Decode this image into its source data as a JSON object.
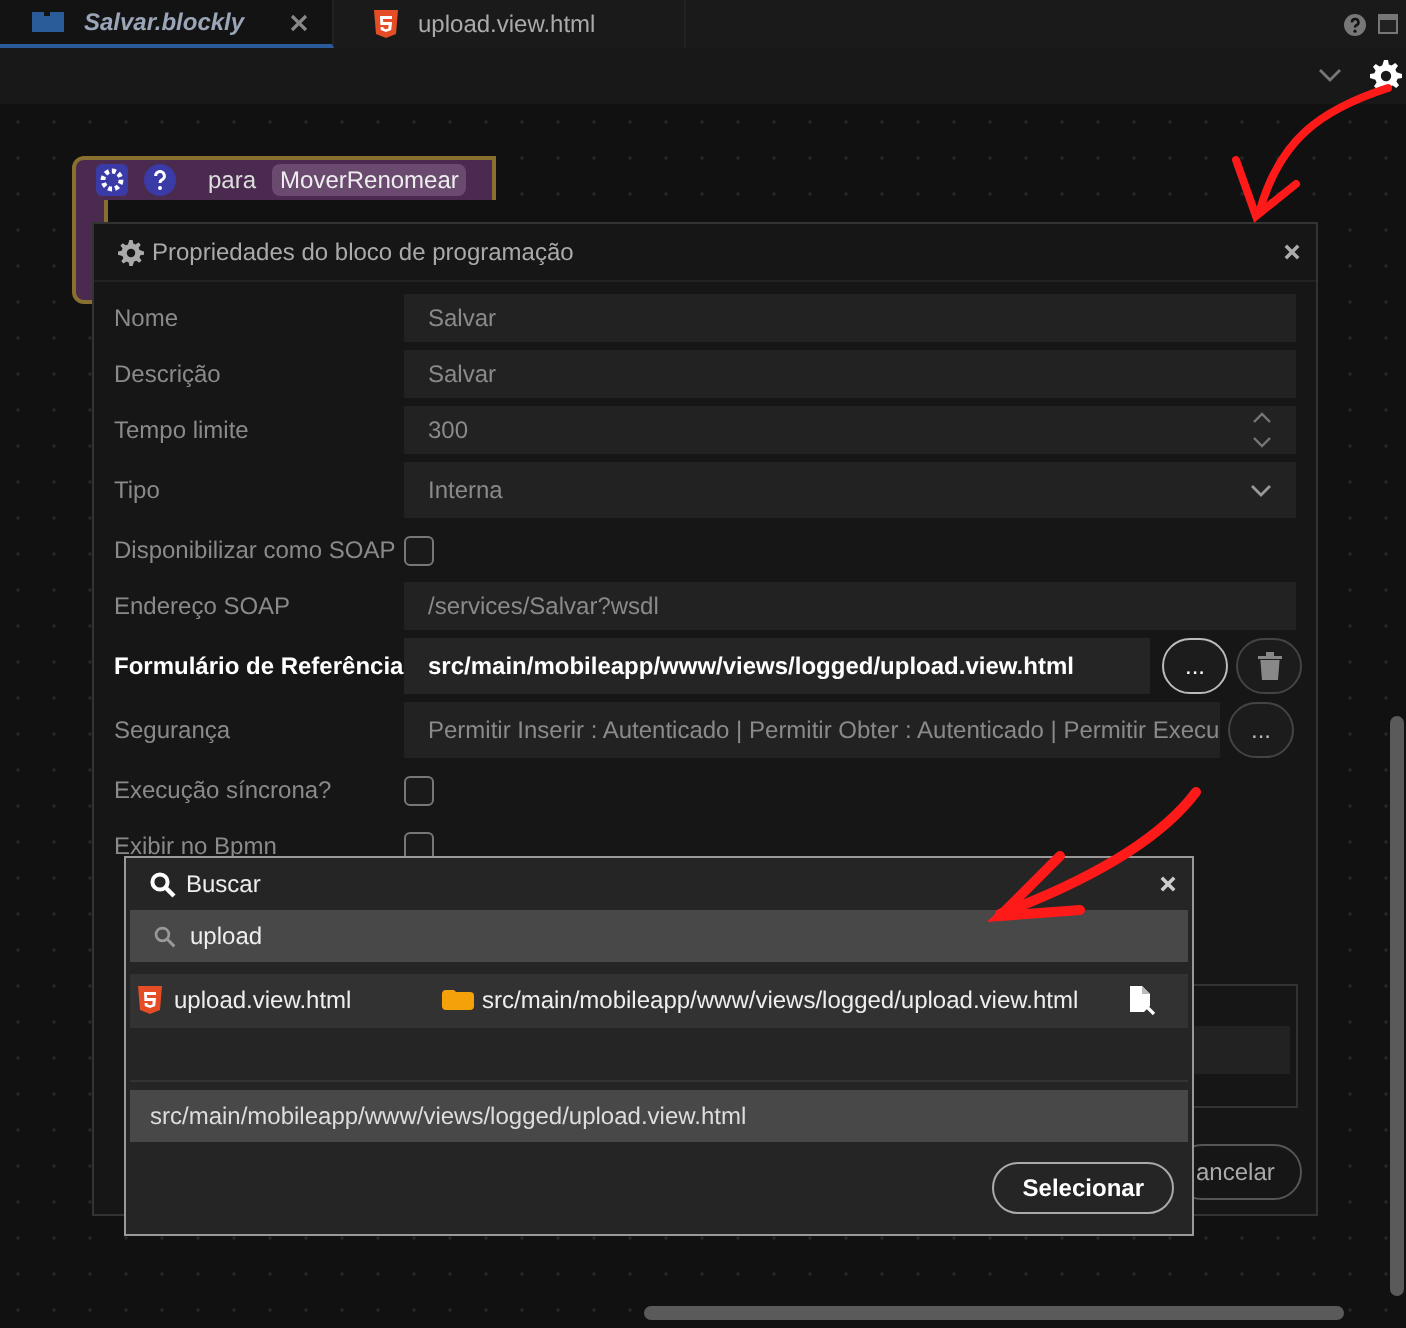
{
  "tabs": [
    {
      "label": "Salvar.blockly",
      "kind": "blockly",
      "selected": true
    },
    {
      "label": "upload.view.html",
      "kind": "html",
      "selected": false
    }
  ],
  "block": {
    "keyword": "para",
    "name": "MoverRenomear"
  },
  "properties_dialog": {
    "title": "Propriedades do bloco de programação",
    "fields": [
      {
        "kind": "text",
        "label": "Nome",
        "value": "Salvar",
        "disabled": true
      },
      {
        "kind": "text",
        "label": "Descrição",
        "value": "Salvar",
        "disabled": true
      },
      {
        "kind": "number",
        "label": "Tempo limite",
        "value": "300",
        "disabled": true
      },
      {
        "kind": "select",
        "label": "Tipo",
        "value": "Interna",
        "disabled": true
      },
      {
        "kind": "checkbox",
        "label": "Disponibilizar como SOAP",
        "checked": false,
        "disabled": true
      },
      {
        "kind": "text",
        "label": "Endereço SOAP",
        "value": "/services/Salvar?wsdl",
        "disabled": true
      },
      {
        "kind": "file",
        "label": "Formulário de Referência",
        "value": "src/main/mobileapp/www/views/logged/upload.view.html",
        "button": "...",
        "disabled": false
      },
      {
        "kind": "picker",
        "label": "Segurança",
        "value": "Permitir Inserir : Autenticado | Permitir Obter : Autenticado | Permitir Execu",
        "button": "...",
        "disabled": true
      },
      {
        "kind": "checkbox",
        "label": "Execução síncrona?",
        "checked": false,
        "disabled": true
      },
      {
        "kind": "checkbox",
        "label": "Exibir no Bpmn",
        "checked": false,
        "disabled": true
      }
    ],
    "cancel_button": "ancelar"
  },
  "search_dialog": {
    "title": "Buscar",
    "query": "upload",
    "results": [
      {
        "name": "upload.view.html",
        "path": "src/main/mobileapp/www/views/logged/upload.view.html",
        "selected": true
      }
    ],
    "selected_path": "src/main/mobileapp/www/views/logged/upload.view.html",
    "button": "Selecionar"
  }
}
